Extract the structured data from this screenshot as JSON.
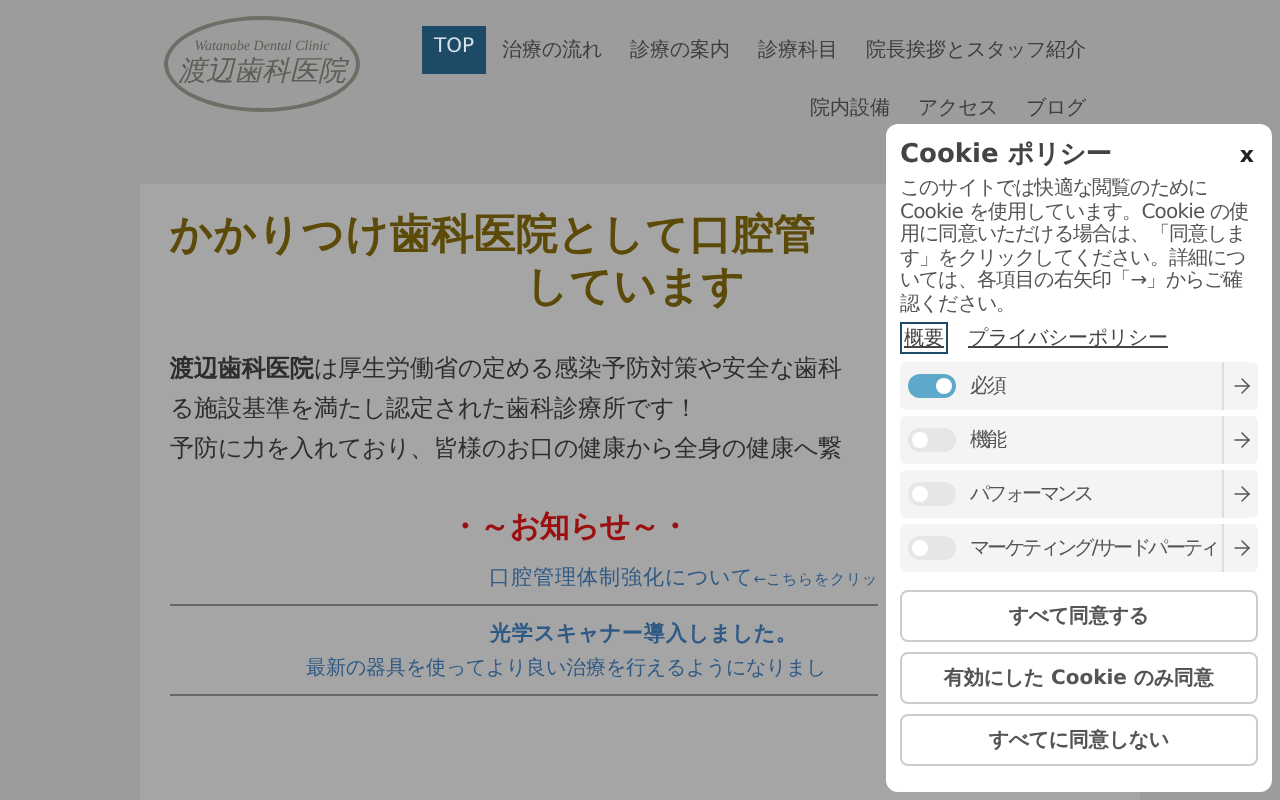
{
  "header": {
    "logo": {
      "script": "Watanabe Dental Clinic",
      "name": "渡辺歯科医院"
    },
    "nav_rows": [
      [
        {
          "label": "TOP",
          "selected": true
        },
        {
          "label": "治療の流れ",
          "selected": false
        },
        {
          "label": "診療の案内",
          "selected": false
        },
        {
          "label": "診療科目",
          "selected": false
        },
        {
          "label": "院長挨拶とスタッフ紹介",
          "selected": false
        }
      ],
      [
        {
          "label": "院内設備",
          "selected": false
        },
        {
          "label": "アクセス",
          "selected": false
        },
        {
          "label": "ブログ",
          "selected": false
        }
      ]
    ]
  },
  "main": {
    "heading_lines": [
      "かかりつけ歯科医院として口腔管",
      "しています"
    ],
    "paragraph_lines": [
      "**渡辺歯科医院**は厚生労働省の定める感染予防対策や安全な歯科",
      "る施設基準を満たし認定された歯科診療所です！",
      "予防に力を入れており、皆様のお口の健康から全身の健康へ繋"
    ],
    "notice_title": "・～お知らせ～・",
    "notices": [
      {
        "kind": "link",
        "title": "口腔管理体制強化について",
        "note": "←こちらをクリッ"
      },
      {
        "kind": "news",
        "title": "光学スキャナー導入しました。",
        "body": "最新の器具を使ってより良い治療を行えるようになりまし"
      }
    ]
  },
  "cookie_dialog": {
    "title": "Cookie ポリシー",
    "close": "x",
    "description": "このサイトでは快適な閲覧のために Cookie を使用しています。Cookie の使用に同意いただける場合は、「同意します」をクリックしてください。詳細については、各項目の右矢印「→」からご確認ください。",
    "links": [
      {
        "label": "概要",
        "selected": true
      },
      {
        "label": "プライバシーポリシー",
        "selected": false
      }
    ],
    "categories": [
      {
        "label": "必須",
        "on": true
      },
      {
        "label": "機能",
        "on": false
      },
      {
        "label": "パフォーマンス",
        "on": false
      },
      {
        "label": "マーケティング/サードパーティ",
        "on": false
      }
    ],
    "buttons": [
      "すべて同意する",
      "有効にした Cookie のみ同意",
      "すべてに同意しない"
    ]
  }
}
